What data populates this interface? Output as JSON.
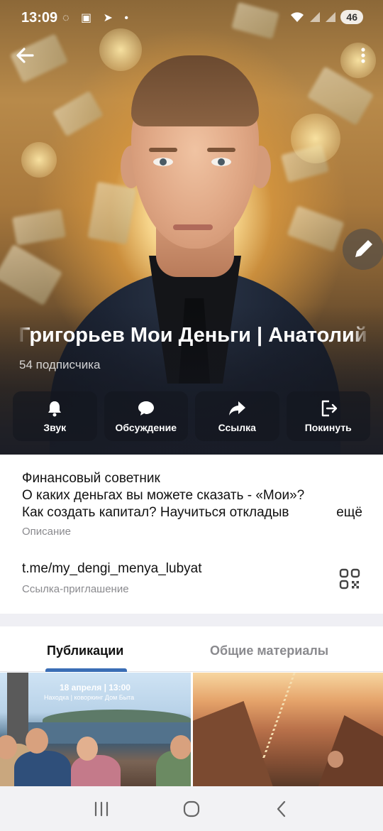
{
  "status_bar": {
    "time": "13:09",
    "notification_icons": "◌ ▣ ➤ •",
    "battery": "46",
    "signal_icons": "wifi-icon signal-icon signal-icon"
  },
  "channel": {
    "name": "Григорьев    Мои Деньги | Анатолий",
    "subscribers": "54 подписчика"
  },
  "actions": [
    {
      "label": "Звук",
      "icon": "bell-icon"
    },
    {
      "label": "Обсуждение",
      "icon": "chat-bubble-icon"
    },
    {
      "label": "Ссылка",
      "icon": "share-arrow-icon"
    },
    {
      "label": "Покинуть",
      "icon": "exit-icon"
    }
  ],
  "description": {
    "line1": "Финансовый советник",
    "line2": "О каких деньгах вы можете сказать - «Мои»?",
    "line3": "Как создать капитал? Научиться откладыв",
    "more": "ещё",
    "label": "Описание"
  },
  "invite": {
    "link": "t.me/my_dengi_menya_lubyat",
    "label": "Ссылка-приглашение"
  },
  "tabs": {
    "active": "Публикации",
    "inactive": "Общие материалы"
  },
  "media": {
    "thumb1_date": "18 апреля | 13:00",
    "thumb1_place": "Находка | коворкинг Дом Быта"
  },
  "colors": {
    "accent": "#3a6db5",
    "secondary_text": "#8a8a8e",
    "separator": "#efeff4"
  }
}
